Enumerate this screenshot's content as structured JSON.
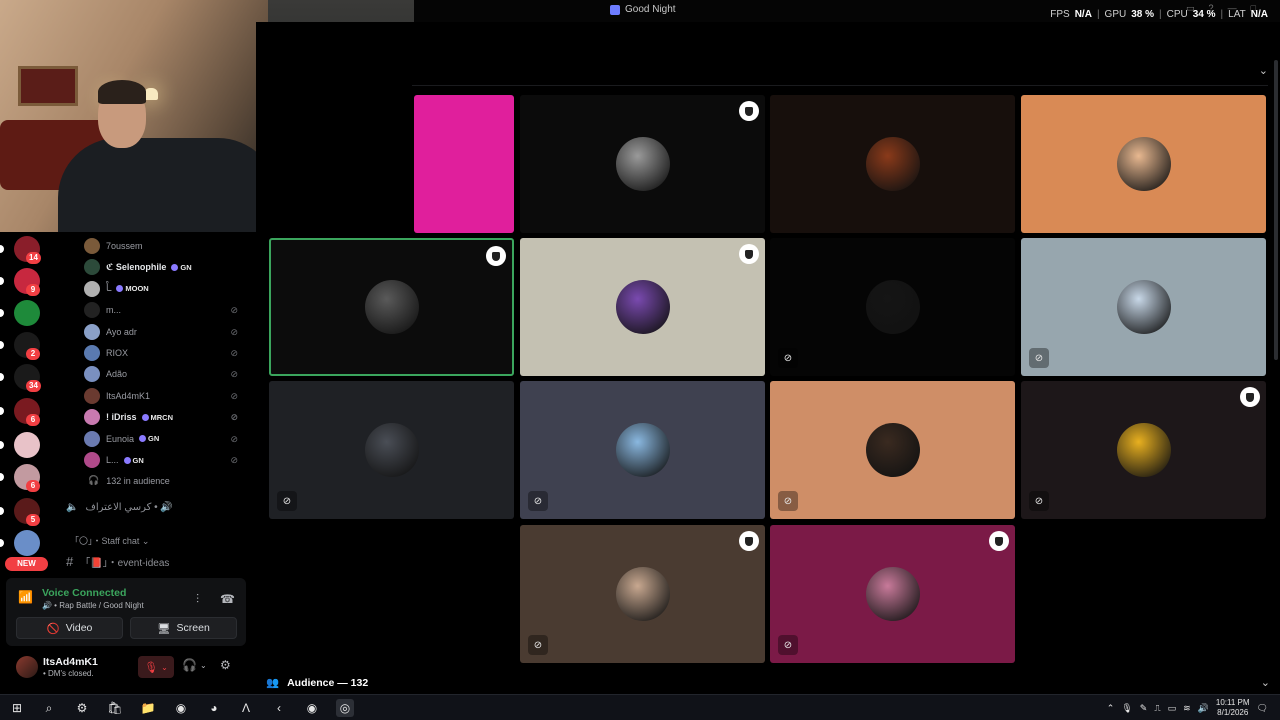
{
  "window": {
    "title": "Good Night",
    "perf": {
      "fps_label": "FPS",
      "fps_value": "N/A",
      "gpu_label": "GPU",
      "gpu_value": "38 %",
      "cpu_label": "CPU",
      "cpu_value": "34 %",
      "lat_label": "LAT",
      "lat_value": "N/A"
    }
  },
  "servers": [
    {
      "badge": "14",
      "color": "#8a1e2a"
    },
    {
      "badge": "9",
      "color": "#c7283f"
    },
    {
      "badge": "",
      "color": "#1e8a3a"
    },
    {
      "badge": "2",
      "color": "#1a1a1a"
    },
    {
      "badge": "34",
      "color": "#1a1a1a"
    },
    {
      "badge": "6",
      "color": "#7a1a20"
    },
    {
      "badge": "",
      "color": "#e8c2c8"
    },
    {
      "badge": "6",
      "color": "#c29aa0"
    },
    {
      "badge": "5",
      "color": "#5a1a1a"
    },
    {
      "badge": "",
      "color": "#6a8ec8"
    }
  ],
  "new_badge": "NEW",
  "voice_users": [
    {
      "name": "7oussem",
      "tag": "",
      "muted": false,
      "color": "#7a5a3a"
    },
    {
      "name": "ℭ Selenophile",
      "tag": "GN",
      "muted": false,
      "color": "#2c4a3a",
      "bright": true
    },
    {
      "name": "ـاْ",
      "tag": "MOON",
      "muted": false,
      "color": "#b0b0b0"
    },
    {
      "name": "m...",
      "tag": "",
      "muted": true,
      "color": "#222"
    },
    {
      "name": "Ayo adr",
      "tag": "",
      "muted": true,
      "color": "#8aa0c8"
    },
    {
      "name": "RIOX",
      "tag": "",
      "muted": true,
      "color": "#5a7ab0"
    },
    {
      "name": "Adão",
      "tag": "",
      "muted": true,
      "color": "#7a90c0"
    },
    {
      "name": "ItsAd4mK1",
      "tag": "",
      "muted": true,
      "color": "#6a3a30"
    },
    {
      "name": "! iDriss",
      "tag": "MRCN",
      "muted": true,
      "color": "#c87ab0",
      "bright": true
    },
    {
      "name": "Eunoia",
      "tag": "GN",
      "muted": true,
      "color": "#6a7ab0"
    },
    {
      "name": "L...",
      "tag": "GN",
      "muted": true,
      "color": "#b04a8a"
    }
  ],
  "audience_count_text": "132 in audience",
  "channels": [
    {
      "icon": "🔊",
      "name": "كرسي الاعتراف • 🔊"
    },
    {
      "icon": "",
      "name": "「〇」・Staff chat ⌄"
    },
    {
      "icon": "#",
      "name": "「📕」・event-ideas"
    }
  ],
  "voice_panel": {
    "status": "Voice Connected",
    "channel": "🔊 • Rap Battle / Good Night",
    "video_label": "Video",
    "screen_label": "Screen"
  },
  "user": {
    "name": "ItsAd4mK1",
    "status": "• DM's closed."
  },
  "stage": {
    "audience_header": "Audience — 132",
    "tiles": [
      {
        "bg": "#e01f9c",
        "pic": "",
        "mod": false,
        "muted": false,
        "col": 0,
        "row": 0,
        "partial": true
      },
      {
        "bg": "#0b0b0b",
        "pic": "#9a9a9a",
        "mod": true,
        "muted": false,
        "col": 1,
        "row": 0
      },
      {
        "bg": "#170f0c",
        "pic": "#8a3a1a",
        "mod": false,
        "muted": false,
        "col": 2,
        "row": 0
      },
      {
        "bg": "#d98a55",
        "pic": "#e8b890",
        "mod": false,
        "muted": false,
        "col": 3,
        "row": 0
      },
      {
        "bg": "#0c0c0c",
        "pic": "#5a5a5a",
        "mod": true,
        "muted": false,
        "col": 0,
        "row": 1,
        "speaking": true
      },
      {
        "bg": "#c4c1b2",
        "pic": "#7a4ab0",
        "mod": true,
        "muted": false,
        "col": 1,
        "row": 1
      },
      {
        "bg": "#050505",
        "pic": "#151515",
        "mod": false,
        "muted": true,
        "col": 2,
        "row": 1
      },
      {
        "bg": "#97a6ae",
        "pic": "#c8d8e8",
        "mod": false,
        "muted": true,
        "col": 3,
        "row": 1
      },
      {
        "bg": "#1f2125",
        "pic": "#4a4e56",
        "mod": false,
        "muted": true,
        "col": 0,
        "row": 2
      },
      {
        "bg": "#3f4150",
        "pic": "#8ab8e0",
        "mod": false,
        "muted": true,
        "col": 1,
        "row": 2
      },
      {
        "bg": "#cf8e67",
        "pic": "#3a2a20",
        "mod": false,
        "muted": true,
        "col": 2,
        "row": 2
      },
      {
        "bg": "#1d1719",
        "pic": "#e8b020",
        "mod": true,
        "muted": true,
        "col": 3,
        "row": 2
      },
      {
        "bg": "#4a3b31",
        "pic": "#c8a890",
        "mod": true,
        "muted": true,
        "col": 1,
        "row": 3
      },
      {
        "bg": "#7b1a47",
        "pic": "#c87a9a",
        "mod": true,
        "muted": true,
        "col": 2,
        "row": 3
      }
    ]
  },
  "taskbar": {
    "time": "10:11 PM",
    "date": "8/1/2026",
    "apps": [
      "start-icon",
      "search-icon",
      "settings-icon",
      "store-icon",
      "files-icon",
      "chrome-icon",
      "discord-icon",
      "terminal-icon",
      "app-icon",
      "chrome-icon",
      "record-icon"
    ]
  }
}
